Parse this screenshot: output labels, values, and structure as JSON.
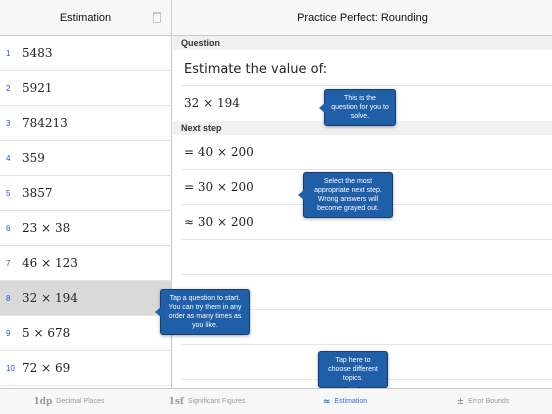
{
  "left": {
    "title": "Estimation",
    "items": [
      {
        "num": "1",
        "expr": "5483"
      },
      {
        "num": "2",
        "expr": "5921"
      },
      {
        "num": "3",
        "expr": "784213"
      },
      {
        "num": "4",
        "expr": "359"
      },
      {
        "num": "5",
        "expr": "3857"
      },
      {
        "num": "6",
        "expr": "23 × 38"
      },
      {
        "num": "7",
        "expr": "46 × 123"
      },
      {
        "num": "8",
        "expr": "32 × 194"
      },
      {
        "num": "9",
        "expr": "5 × 678"
      },
      {
        "num": "10",
        "expr": "72 × 69"
      }
    ],
    "selected_index": 7
  },
  "right": {
    "title": "Practice Perfect: Rounding",
    "question_header": "Question",
    "prompt": "Estimate the value of:",
    "question": "32 × 194",
    "next_step_header": "Next step",
    "steps": [
      "= 40 × 200",
      "= 30 × 200",
      "≈ 30 × 200"
    ]
  },
  "tooltips": {
    "question": "This is the question for you to solve.",
    "next_step": "Select the most appropriate next step. Wrong answers will become grayed out.",
    "start": "Tap a question to start. You can try them in any order as many times as you like.",
    "topics": "Tap here to choose different topics."
  },
  "tabs": [
    {
      "icon": "1dp",
      "label": "Decimal Places",
      "active": false
    },
    {
      "icon": "1sf",
      "label": "Significant Figures",
      "active": false
    },
    {
      "icon": "≈",
      "label": "Estimation",
      "active": true
    },
    {
      "icon": "±",
      "label": "Error Bounds",
      "active": false
    }
  ],
  "colors": {
    "accent": "#2f6fdf",
    "tooltip": "#1f5fa8",
    "row_number": "#2a51d6"
  }
}
